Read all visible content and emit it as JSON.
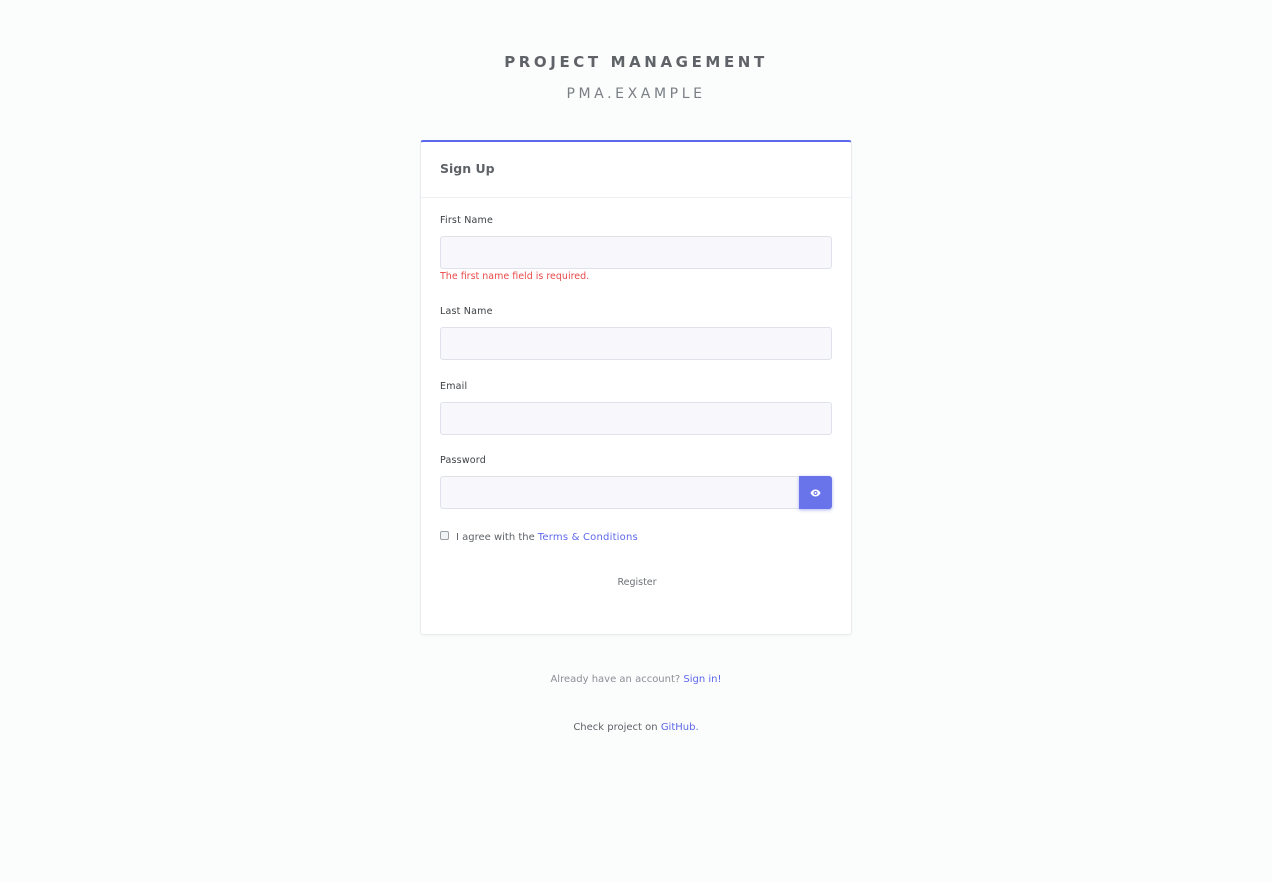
{
  "brand": {
    "title": "PROJECT MANAGEMENT",
    "subtitle": "PMA.EXAMPLE"
  },
  "form": {
    "header": "Sign Up",
    "first_name": {
      "label": "First Name",
      "value": "",
      "error": "The first name field is required."
    },
    "last_name": {
      "label": "Last Name",
      "value": ""
    },
    "email": {
      "label": "Email",
      "value": ""
    },
    "password": {
      "label": "Password",
      "value": "",
      "toggle_icon": "eye-icon"
    },
    "terms": {
      "checked": false,
      "prefix": "I agree with the",
      "link": "Terms & Conditions"
    },
    "register_label": "Register"
  },
  "footer": {
    "account_prefix": "Already have an account?",
    "sign_in_link": "Sign in!",
    "github_prefix": "Check project on",
    "github_link": "GitHub."
  },
  "colors": {
    "accent": "#5d68ea",
    "error": "#ea4a4a",
    "background": "#fbfcfc"
  }
}
